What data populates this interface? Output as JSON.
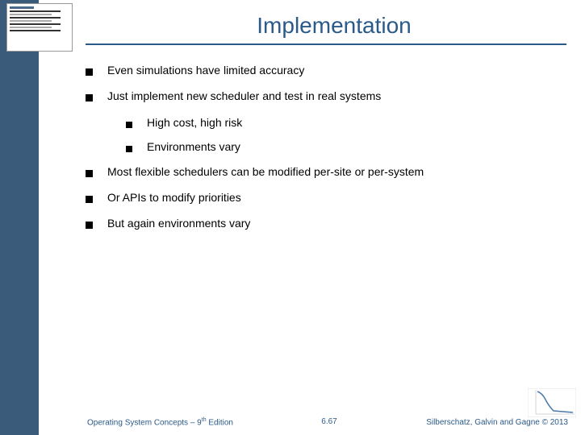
{
  "title": "Implementation",
  "bullets": {
    "b1": "Even simulations have limited accuracy",
    "b2": "Just implement new scheduler and test in real systems",
    "b2a": "High cost, high risk",
    "b2b": "Environments vary",
    "b3": "Most flexible schedulers can be modified per-site or per-system",
    "b4": "Or APIs to modify priorities",
    "b5": "But again environments vary"
  },
  "footer": {
    "left_prefix": "Operating System Concepts – 9",
    "left_sup": "th",
    "left_suffix": " Edition",
    "mid": "6.67",
    "right": "Silberschatz, Galvin and Gagne © 2013"
  }
}
